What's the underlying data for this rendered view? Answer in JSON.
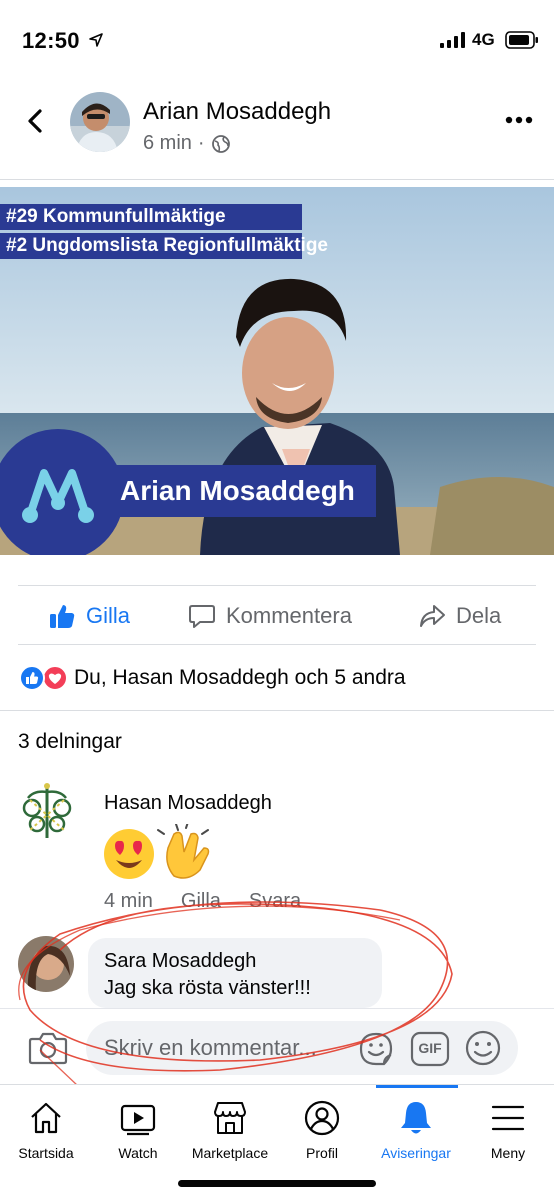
{
  "status_bar": {
    "time": "12:50",
    "network": "4G"
  },
  "post": {
    "author": "Arian Mosaddegh",
    "time": "6 min",
    "image": {
      "tag_line_1": "#29 Kommunfullmäktige",
      "tag_line_2": "#2 Ungdomslista Regionfullmäktige",
      "banner_name": "Arian Mosaddegh"
    },
    "actions": {
      "like": "Gilla",
      "comment": "Kommentera",
      "share": "Dela"
    },
    "reactions_text": "Du, Hasan Mosaddegh och 5 andra",
    "shares_text": "3 delningar"
  },
  "comments": [
    {
      "name": "Hasan Mosaddegh",
      "time": "4 min",
      "like": "Gilla",
      "reply": "Svara"
    },
    {
      "name": "Sara Mosaddegh",
      "text": "Jag ska rösta vänster!!!"
    }
  ],
  "composer": {
    "placeholder": "Skriv en kommentar...",
    "gif_label": "GIF"
  },
  "tabs": [
    {
      "label": "Startsida"
    },
    {
      "label": "Watch"
    },
    {
      "label": "Marketplace"
    },
    {
      "label": "Profil"
    },
    {
      "label": "Aviseringar"
    },
    {
      "label": "Meny"
    }
  ],
  "colors": {
    "accent": "#1877f2",
    "banner": "#2a3a93",
    "annotation": "#e0301e"
  }
}
